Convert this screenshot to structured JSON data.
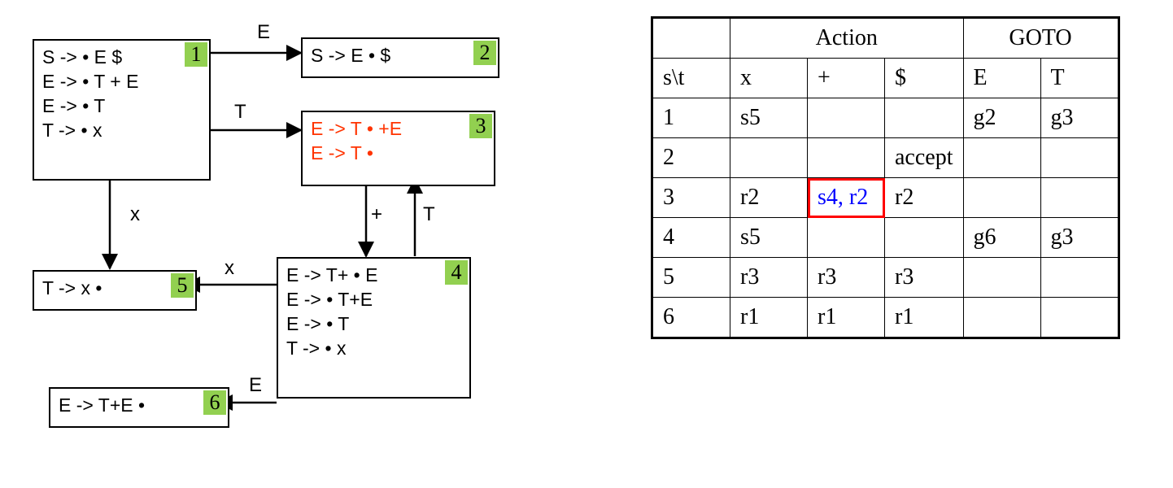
{
  "diagram": {
    "states": {
      "s1": {
        "badge": "1",
        "items": [
          "S -> • E $",
          "E -> • T + E",
          "E -> • T",
          "T -> • x"
        ]
      },
      "s2": {
        "badge": "2",
        "items": [
          "S -> E • $"
        ]
      },
      "s3": {
        "badge": "3",
        "items": [
          "E -> T • +E",
          "E -> T •"
        ]
      },
      "s4": {
        "badge": "4",
        "items": [
          "E -> T+ • E",
          "E -> • T+E",
          "E -> • T",
          "T -> • x"
        ]
      },
      "s5": {
        "badge": "5",
        "items": [
          "T -> x •"
        ]
      },
      "s6": {
        "badge": "6",
        "items": [
          "E -> T+E •"
        ]
      }
    },
    "edges": {
      "e1": "E",
      "e2": "T",
      "e3": "x",
      "e4": "x",
      "e5": "+",
      "e6": "T",
      "e7": "E"
    }
  },
  "table": {
    "header_action": "Action",
    "header_goto": "GOTO",
    "corner": "s\\t",
    "cols_action": [
      "x",
      "+",
      "$"
    ],
    "cols_goto": [
      "E",
      "T"
    ],
    "rows": [
      {
        "state": "1",
        "x": "s5",
        "plus": "",
        "dollar": "",
        "E": "g2",
        "T": "g3"
      },
      {
        "state": "2",
        "x": "",
        "plus": "",
        "dollar": "accept",
        "E": "",
        "T": ""
      },
      {
        "state": "3",
        "x": "r2",
        "plus": "s4, r2",
        "dollar": "r2",
        "E": "",
        "T": ""
      },
      {
        "state": "4",
        "x": "s5",
        "plus": "",
        "dollar": "",
        "E": "g6",
        "T": "g3"
      },
      {
        "state": "5",
        "x": "r3",
        "plus": "r3",
        "dollar": "r3",
        "E": "",
        "T": ""
      },
      {
        "state": "6",
        "x": "r1",
        "plus": "r1",
        "dollar": "r1",
        "E": "",
        "T": ""
      }
    ],
    "conflict_cell": {
      "row": "3",
      "col": "plus"
    }
  }
}
